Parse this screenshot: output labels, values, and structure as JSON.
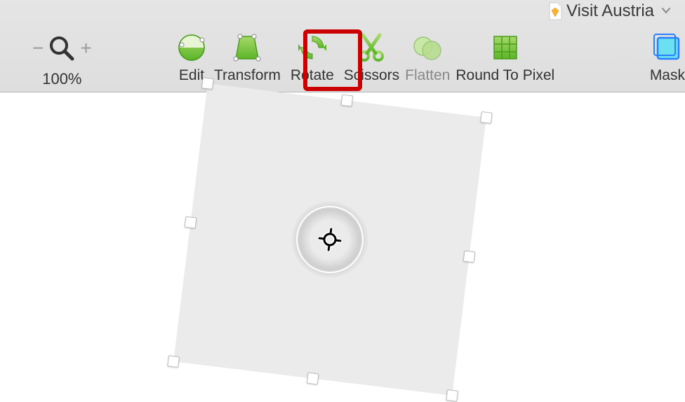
{
  "document": {
    "title": "Visit Austria"
  },
  "zoom": {
    "level": "100%",
    "minus": "−",
    "plus": "+"
  },
  "toolbar": {
    "edit": "Edit",
    "transform": "Transform",
    "rotate": "Rotate",
    "scissors": "Scissors",
    "flatten": "Flatten",
    "round_to_pixel": "Round To Pixel",
    "mask": "Mask"
  },
  "highlighted_tool": "rotate",
  "icons": {
    "edit": "edit-icon",
    "transform": "transform-icon",
    "rotate": "rotate-icon",
    "scissors": "scissors-icon",
    "flatten": "flatten-icon",
    "round_to_pixel": "round-to-pixel-icon",
    "mask": "mask-icon",
    "magnifier": "magnifier-icon",
    "chevron_down": "chevron-down-icon",
    "doc": "sketch-doc-icon",
    "crosshair": "pivot-crosshair-icon"
  },
  "colors": {
    "accent_green_light": "#a6d96a",
    "accent_green_dark": "#5cb528",
    "mask_fill": "#6be0f0",
    "mask_stroke": "#2a7fff"
  },
  "canvas": {
    "shape_rotation_deg": 7
  }
}
